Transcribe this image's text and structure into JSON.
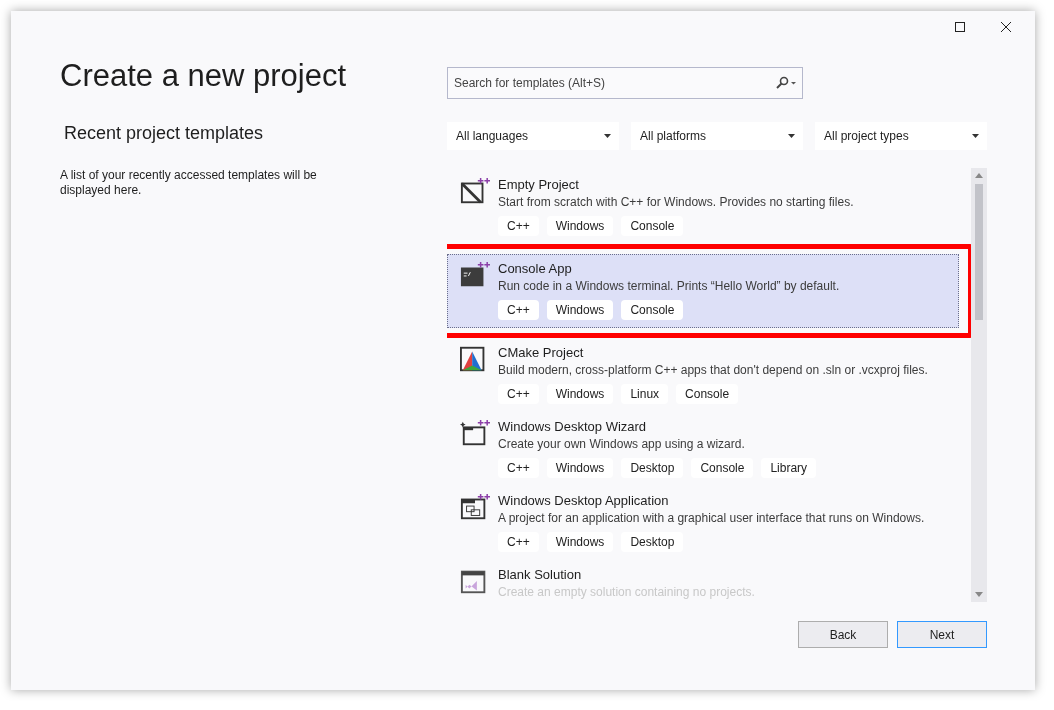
{
  "window": {
    "controls": [
      {
        "kind": "maximize"
      },
      {
        "kind": "close"
      }
    ]
  },
  "title": "Create a new project",
  "recent": {
    "heading": "Recent project templates",
    "message": "A list of your recently accessed templates will be displayed here."
  },
  "search": {
    "placeholder": "Search for templates (Alt+S)"
  },
  "filters": [
    {
      "label": "All languages"
    },
    {
      "label": "All platforms"
    },
    {
      "label": "All project types"
    }
  ],
  "templates": [
    {
      "kind": "empty",
      "name": "Empty Project",
      "description": "Start from scratch with C++ for Windows. Provides no starting files.",
      "tags": [
        "C++",
        "Windows",
        "Console"
      ],
      "selected": false,
      "highlighted": false
    },
    {
      "kind": "console",
      "name": "Console App",
      "description": "Run code in a Windows terminal. Prints “Hello World” by default.",
      "tags": [
        "C++",
        "Windows",
        "Console"
      ],
      "selected": true,
      "highlighted": true
    },
    {
      "kind": "cmake",
      "name": "CMake Project",
      "description": "Build modern, cross-platform C++ apps that don't depend on .sln or .vcxproj files.",
      "tags": [
        "C++",
        "Windows",
        "Linux",
        "Console"
      ],
      "selected": false,
      "highlighted": false
    },
    {
      "kind": "wizard",
      "name": "Windows Desktop Wizard",
      "description": "Create your own Windows app using a wizard.",
      "tags": [
        "C++",
        "Windows",
        "Desktop",
        "Console",
        "Library"
      ],
      "selected": false,
      "highlighted": false
    },
    {
      "kind": "desktop",
      "name": "Windows Desktop Application",
      "description": "A project for an application with a graphical user interface that runs on Windows.",
      "tags": [
        "C++",
        "Windows",
        "Desktop"
      ],
      "selected": false,
      "highlighted": false
    },
    {
      "kind": "blank",
      "name": "Blank Solution",
      "description": "Create an empty solution containing no projects.",
      "selected": false,
      "highlighted": false
    }
  ],
  "buttons": [
    {
      "label": "Back",
      "focused": false
    },
    {
      "label": "Next",
      "focused": true
    }
  ]
}
